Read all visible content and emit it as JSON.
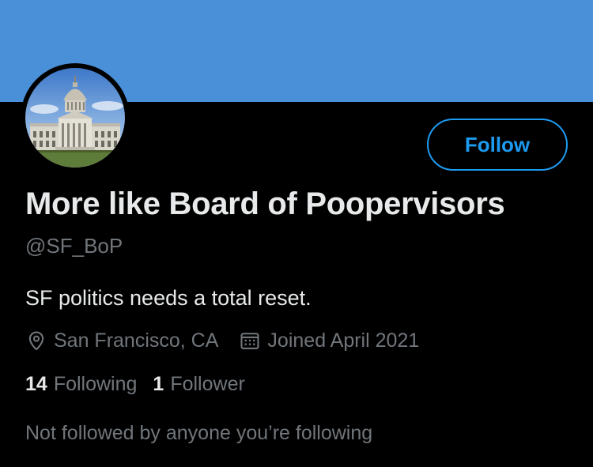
{
  "banner": {
    "color": "#4a90d9"
  },
  "avatar": {
    "subject": "city-hall-dome-icon"
  },
  "follow_button": {
    "label": "Follow",
    "color": "#1d9bf0"
  },
  "profile": {
    "display_name": "More like Board of Poopervisors",
    "handle": "@SF_BoP",
    "bio": "SF politics needs a total reset.",
    "location": "San Francisco, CA",
    "location_icon": "location-pin-icon",
    "joined": "Joined April 2021",
    "joined_icon": "calendar-icon"
  },
  "stats": {
    "following_count": "14",
    "following_label": "Following",
    "followers_count": "1",
    "followers_label": "Follower"
  },
  "followed_by_text": "Not followed by anyone you’re following",
  "colors": {
    "background": "#000000",
    "primary_text": "#e7e9ea",
    "secondary_text": "#71767b",
    "accent": "#1d9bf0"
  }
}
